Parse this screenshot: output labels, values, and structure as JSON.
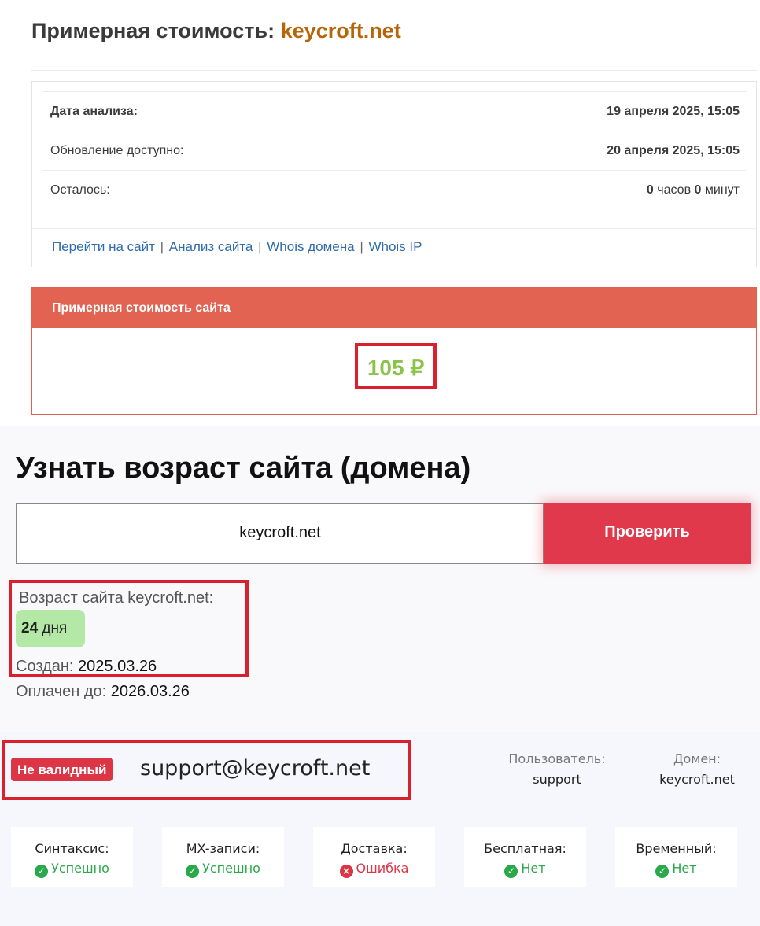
{
  "valuation": {
    "title_prefix": "Примерная стоимость:",
    "domain": "keycroft.net",
    "rows": [
      {
        "label": "Дата анализа:",
        "value": "19 апреля 2025, 15:05"
      },
      {
        "label": "Обновление доступно:",
        "value": "20 апреля 2025, 15:05"
      }
    ],
    "remaining": {
      "label": "Осталось:",
      "hours": "0",
      "hours_unit": "часов",
      "minutes": "0",
      "minutes_unit": "минут"
    },
    "links": [
      "Перейти на сайт",
      "Анализ сайта",
      "Whois домена",
      "Whois IP"
    ],
    "price_header": "Примерная стоимость сайта",
    "price": "105 ₽"
  },
  "age_checker": {
    "title": "Узнать возраст сайта (домена)",
    "input_value": "keycroft.net",
    "button_label": "Проверить",
    "age_label": "Возраст сайта keycroft.net:",
    "age_number": "24",
    "age_unit": "дня",
    "created_label": "Создан:",
    "created_value": "2025.03.26",
    "paid_label": "Оплачен до:",
    "paid_value": "2026.03.26"
  },
  "email_check": {
    "badge": "Не валидный",
    "email": "support@keycroft.net",
    "user_label": "Пользователь:",
    "user_value": "support",
    "domain_label": "Домен:",
    "domain_value": "keycroft.net",
    "checks": [
      {
        "label": "Синтаксис:",
        "status": "Успешно",
        "kind": "ok"
      },
      {
        "label": "MX-записи:",
        "status": "Успешно",
        "kind": "ok"
      },
      {
        "label": "Доставка:",
        "status": "Ошибка",
        "kind": "err"
      },
      {
        "label": "Бесплатная:",
        "status": "Нет",
        "kind": "ok"
      },
      {
        "label": "Временный:",
        "status": "Нет",
        "kind": "ok"
      }
    ]
  },
  "colors": {
    "domain_title": "#b8650a",
    "price_header_bg": "#e26352",
    "price_value": "#8bc34a",
    "check_button": "#e0394b",
    "highlight_border": "#d9202e",
    "age_badge_bg": "#b4e8a6",
    "success": "#2aa84a",
    "error": "#dc3545"
  },
  "icons": {
    "ok": "check-circle-icon",
    "err": "x-circle-icon"
  }
}
